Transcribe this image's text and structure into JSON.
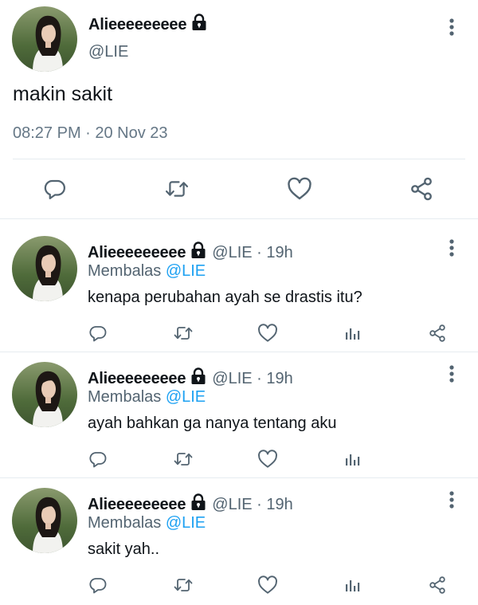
{
  "main": {
    "display_name": "Alieeeeeeeee",
    "handle": "@LIE",
    "text": "makin sakit",
    "timestamp": "08:27 PM · 20 Nov 23"
  },
  "replies": [
    {
      "display_name": "Alieeeeeeeee",
      "handle_time": "@LIE · 19h",
      "replying_prefix": "Membalas",
      "replying_to": "@LIE",
      "text": "kenapa perubahan ayah se drastis itu?"
    },
    {
      "display_name": "Alieeeeeeeee",
      "handle_time": "@LIE · 19h",
      "replying_prefix": "Membalas",
      "replying_to": "@LIE",
      "text": "ayah bahkan ga nanya tentang aku"
    },
    {
      "display_name": "Alieeeeeeeee",
      "handle_time": "@LIE · 19h",
      "replying_prefix": "Membalas",
      "replying_to": "@LIE",
      "text": "sakit yah.."
    }
  ],
  "icons": {
    "reply": "reply-icon",
    "retweet": "retweet-icon",
    "like": "heart-icon",
    "share": "share-icon",
    "analytics": "analytics-icon",
    "more": "more-vertical-icon",
    "protected": "lock-icon"
  },
  "colors": {
    "text": "#0f1419",
    "secondary": "#536471",
    "mention": "#1da1f2",
    "icon": "#536471",
    "divider": "#e6ecf0"
  }
}
